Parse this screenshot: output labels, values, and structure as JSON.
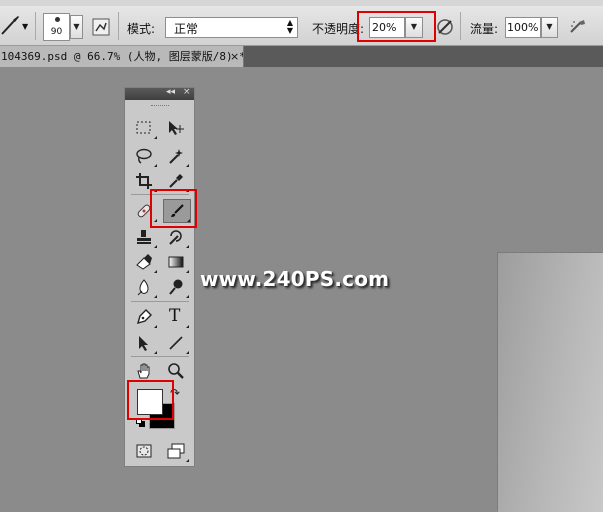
{
  "options_bar": {
    "brush_size": "90",
    "mode_label": "模式:",
    "mode_value": "正常",
    "opacity_label": "不透明度:",
    "opacity_value": "20%",
    "flow_label": "流量:",
    "flow_value": "100%"
  },
  "document_tab": {
    "title": "104369.psd @ 66.7% (人物, 图层蒙版/8) *",
    "close": "×"
  },
  "watermark": "www.240PS.com",
  "tools": {
    "panel_collapse": "◂◂",
    "panel_close": "×",
    "items": [
      {
        "name": "rectangular-marquee-tool"
      },
      {
        "name": "move-tool"
      },
      {
        "name": "lasso-tool"
      },
      {
        "name": "magic-wand-tool"
      },
      {
        "name": "crop-tool"
      },
      {
        "name": "eyedropper-tool"
      },
      {
        "name": "spot-healing-brush-tool"
      },
      {
        "name": "brush-tool",
        "selected": true
      },
      {
        "name": "clone-stamp-tool"
      },
      {
        "name": "history-brush-tool"
      },
      {
        "name": "eraser-tool"
      },
      {
        "name": "gradient-tool"
      },
      {
        "name": "blur-tool"
      },
      {
        "name": "dodge-tool"
      },
      {
        "name": "pen-tool"
      },
      {
        "name": "type-tool",
        "glyph": "T"
      },
      {
        "name": "path-selection-tool"
      },
      {
        "name": "line-tool"
      },
      {
        "name": "hand-tool"
      },
      {
        "name": "zoom-tool"
      },
      {
        "name": "quick-mask-button"
      },
      {
        "name": "screen-mode-button"
      }
    ],
    "foreground_color": "#ffffff",
    "background_color": "#000000"
  },
  "highlight_color": "#e00000"
}
